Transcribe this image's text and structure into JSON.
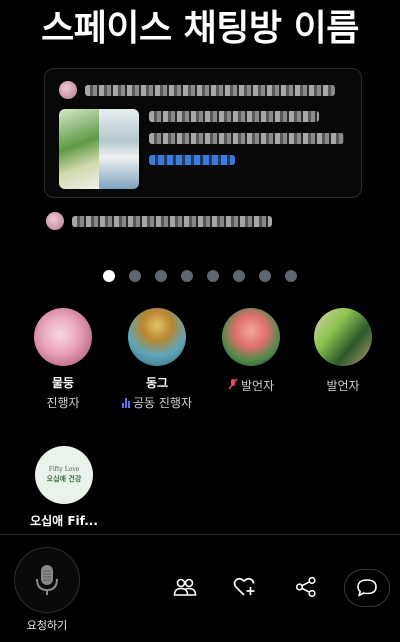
{
  "caption": "스페이스 채팅방 이름",
  "pager": {
    "count": 8,
    "active_index": 0
  },
  "speakers": [
    {
      "name": "물둥",
      "role": "진행자",
      "role_icon": "none"
    },
    {
      "name": "동그",
      "role": "공동 진행자",
      "role_icon": "sound-bars-icon"
    },
    {
      "name": "",
      "role": "발언자",
      "role_icon": "mic-off-icon"
    },
    {
      "name": "",
      "role": "발언자",
      "role_icon": "none"
    }
  ],
  "listener": {
    "name": "오십애 Fif...",
    "avatar_text_small": "Fifty Love",
    "avatar_text_main": "오십애 건강"
  },
  "bottom": {
    "mic_label": "요청하기"
  },
  "colors": {
    "background": "#000000",
    "active_dot": "#ffffff",
    "inactive_dot": "#5b6670",
    "cohost_accent": "#6a6af5",
    "mute_accent": "#e44b64"
  }
}
